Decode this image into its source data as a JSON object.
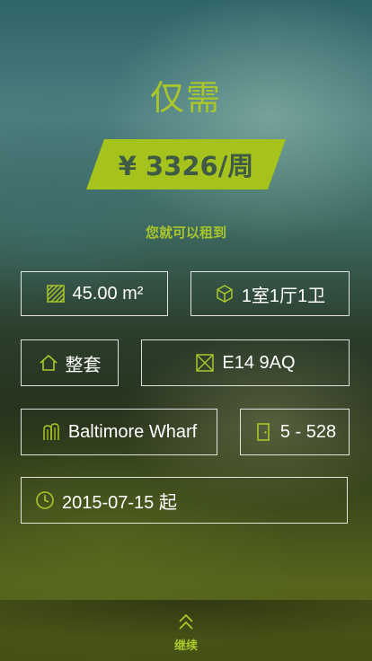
{
  "header": {
    "title": "仅需",
    "price": "¥ 3326/周",
    "subtitle": "您就可以租到"
  },
  "details": {
    "area": "45.00 m²",
    "layout": "1室1厅1卫",
    "rent_type": "整套",
    "postcode": "E14 9AQ",
    "building": "Baltimore Wharf",
    "room": "5 - 528",
    "available_from": "2015-07-15 起"
  },
  "footer": {
    "continue_label": "继续"
  },
  "colors": {
    "accent": "#a6c21d",
    "price_text": "#3f5a45"
  },
  "icons": [
    "area-icon",
    "cube-icon",
    "home-icon",
    "postcode-icon",
    "building-icon",
    "door-icon",
    "clock-icon",
    "double-chevron-up-icon"
  ]
}
